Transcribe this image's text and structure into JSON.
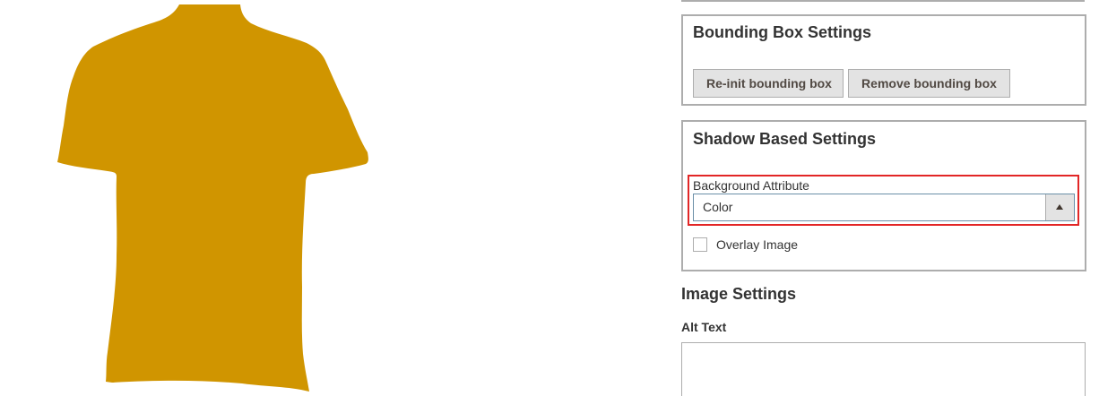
{
  "preview": {
    "garment_color": "#d09500",
    "garment_icon": "tshirt-silhouette"
  },
  "bounding_box": {
    "title": "Bounding Box Settings",
    "reinit_label": "Re-init bounding box",
    "remove_label": "Remove bounding box"
  },
  "shadow": {
    "title": "Shadow Based Settings",
    "background_attribute_label": "Background Attribute",
    "background_attribute_value": "Color",
    "overlay_image_label": "Overlay Image",
    "overlay_image_checked": false,
    "highlight_color": "#e22626"
  },
  "image_settings": {
    "title": "Image Settings",
    "alt_text_label": "Alt Text",
    "alt_text_value": ""
  }
}
